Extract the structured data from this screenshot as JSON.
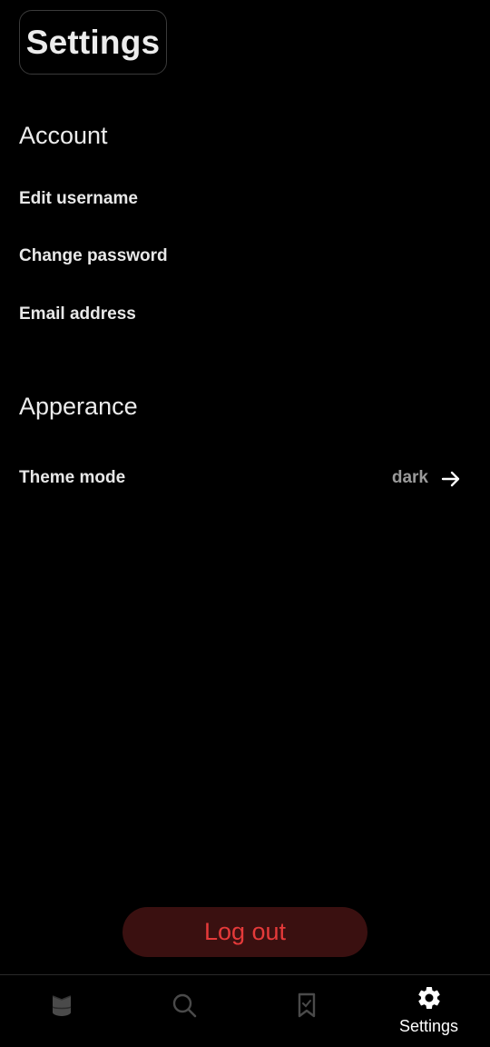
{
  "header": {
    "title": "Settings"
  },
  "account": {
    "title": "Account",
    "items": [
      "Edit username",
      "Change password",
      "Email address"
    ]
  },
  "appearance": {
    "title": "Apperance",
    "theme_label": "Theme mode",
    "theme_value": "dark"
  },
  "logout": {
    "label": "Log out"
  },
  "nav": {
    "items": [
      {
        "icon": "library-icon",
        "label": ""
      },
      {
        "icon": "search-icon",
        "label": ""
      },
      {
        "icon": "bookmark-icon",
        "label": ""
      },
      {
        "icon": "gear-icon",
        "label": "Settings",
        "active": true
      }
    ]
  },
  "colors": {
    "background": "#000000",
    "text": "#e8e8e8",
    "muted": "#9a9a9a",
    "danger": "#e53a3a",
    "danger_bg": "#3a1010",
    "nav_inactive": "#555555"
  }
}
